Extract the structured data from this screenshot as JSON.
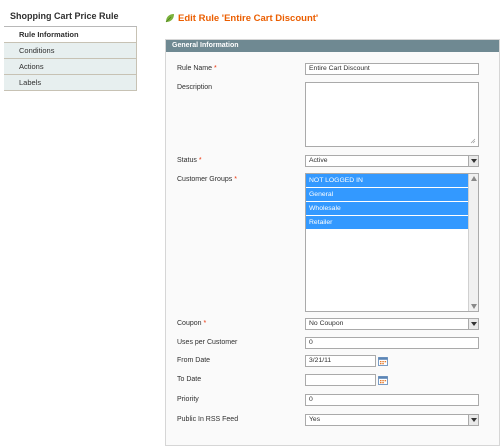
{
  "sidebar": {
    "title": "Shopping Cart Price Rule",
    "tabs": [
      {
        "label": "Rule Information",
        "active": true
      },
      {
        "label": "Conditions",
        "active": false
      },
      {
        "label": "Actions",
        "active": false
      },
      {
        "label": "Labels",
        "active": false
      }
    ]
  },
  "header": {
    "title": "Edit Rule 'Entire Cart Discount'",
    "icon": "leaf-icon"
  },
  "section": {
    "title": "General Information"
  },
  "form": {
    "rule_name": {
      "label": "Rule Name",
      "required": "*",
      "value": "Entire Cart Discount"
    },
    "description": {
      "label": "Description",
      "value": ""
    },
    "status": {
      "label": "Status",
      "required": "*",
      "value": "Active"
    },
    "customer_groups": {
      "label": "Customer Groups",
      "required": "*",
      "options": [
        "NOT LOGGED IN",
        "General",
        "Wholesale",
        "Retailer"
      ]
    },
    "coupon": {
      "label": "Coupon",
      "required": "*",
      "value": "No Coupon"
    },
    "uses_per_customer": {
      "label": "Uses per Customer",
      "value": "0"
    },
    "from_date": {
      "label": "From Date",
      "value": "3/21/11"
    },
    "to_date": {
      "label": "To Date",
      "value": ""
    },
    "priority": {
      "label": "Priority",
      "value": "0"
    },
    "public_rss": {
      "label": "Public In RSS Feed",
      "value": "Yes"
    }
  },
  "colors": {
    "accent": "#eb5e00",
    "section_header": "#6f8992",
    "selected_option": "#3399ff",
    "required": "#eb340a"
  }
}
